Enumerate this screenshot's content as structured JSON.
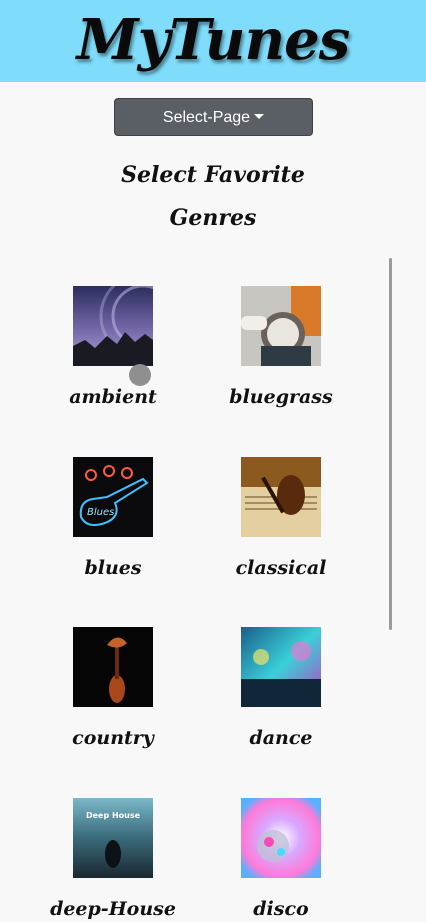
{
  "header": {
    "title": "MyTunes",
    "bg_color": "#7fdcfb"
  },
  "nav": {
    "select_page_label": "Select-Page"
  },
  "section": {
    "title_line1": "Select Favorite",
    "title_line2": "Genres"
  },
  "genres": [
    {
      "label": "ambient",
      "icon": "ambient-thumbnail"
    },
    {
      "label": "bluegrass",
      "icon": "bluegrass-thumbnail"
    },
    {
      "label": "blues",
      "icon": "blues-thumbnail"
    },
    {
      "label": "classical",
      "icon": "classical-thumbnail"
    },
    {
      "label": "country",
      "icon": "country-thumbnail"
    },
    {
      "label": "dance",
      "icon": "dance-thumbnail"
    },
    {
      "label": "deep-House",
      "icon": "deep-house-thumbnail",
      "image_text": "Deep House"
    },
    {
      "label": "disco",
      "icon": "disco-thumbnail"
    }
  ]
}
